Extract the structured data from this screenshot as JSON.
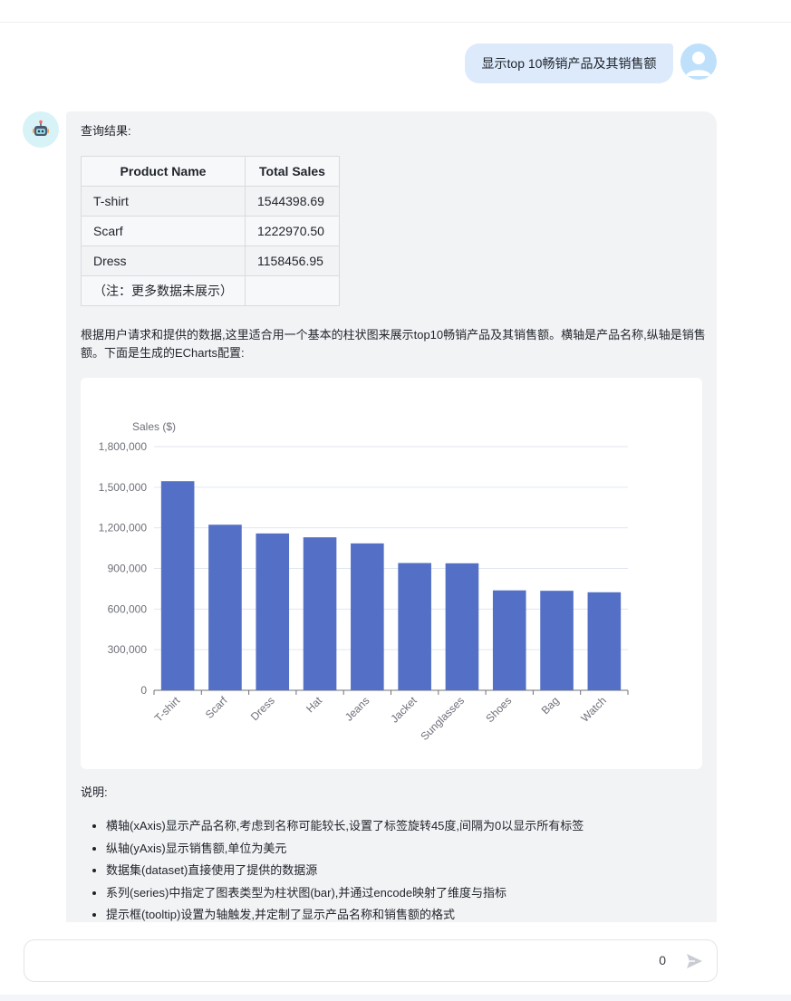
{
  "user_message": "显示top 10畅销产品及其销售额",
  "bot": {
    "result_label": "查询结果:",
    "table": {
      "headers": [
        "Product Name",
        "Total Sales"
      ],
      "rows": [
        [
          "T-shirt",
          "1544398.69"
        ],
        [
          "Scarf",
          "1222970.50"
        ],
        [
          "Dress",
          "1158456.95"
        ],
        [
          "（注：更多数据未展示）",
          ""
        ]
      ]
    },
    "description": "根据用户请求和提供的数据,这里适合用一个基本的柱状图来展示top10畅销产品及其销售额。横轴是产品名称,纵轴是销售额。下面是生成的ECharts配置:",
    "notes_title": "说明:",
    "notes": [
      "横轴(xAxis)显示产品名称,考虑到名称可能较长,设置了标签旋转45度,间隔为0以显示所有标签",
      "纵轴(yAxis)显示销售额,单位为美元",
      "数据集(dataset)直接使用了提供的数据源",
      "系列(series)中指定了图表类型为柱状图(bar),并通过encode映射了维度与指标",
      "提示框(tooltip)设置为轴触发,并定制了显示产品名称和销售额的格式"
    ]
  },
  "chart_data": {
    "type": "bar",
    "categories": [
      "T-shirt",
      "Scarf",
      "Dress",
      "Hat",
      "Jeans",
      "Jacket",
      "Sunglasses",
      "Shoes",
      "Bag",
      "Watch"
    ],
    "values": [
      1544398.69,
      1222970.5,
      1158456.95,
      1130000,
      1085000,
      940000,
      938000,
      738000,
      735000,
      724000
    ],
    "title": "",
    "xlabel": "",
    "ylabel": "Sales ($)",
    "ylim": [
      0,
      1800000
    ],
    "yticks": [
      "0",
      "300,000",
      "600,000",
      "900,000",
      "1,200,000",
      "1,500,000",
      "1,800,000"
    ],
    "x_label_rotation": 45,
    "grid": true,
    "bar_color": "#5470c6"
  },
  "input": {
    "char_count": "0"
  },
  "colors": {
    "user_bubble": "#dceafc",
    "bot_card": "#f2f3f5",
    "accent": "#5470c6"
  }
}
